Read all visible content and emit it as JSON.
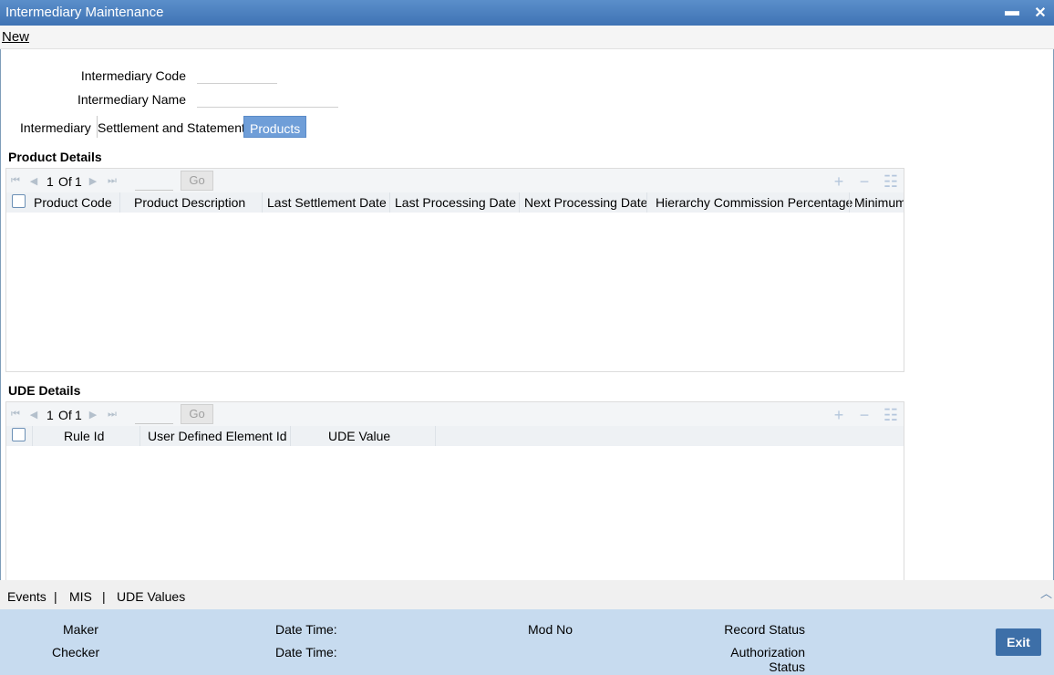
{
  "window": {
    "title": "Intermediary Maintenance",
    "minimize_glyph": "▬",
    "close_glyph": "✕"
  },
  "menu": {
    "new_label": "New"
  },
  "form": {
    "code_label": "Intermediary Code",
    "code_value": "",
    "name_label": "Intermediary Name",
    "name_value": ""
  },
  "tabs": [
    {
      "label": "Intermediary"
    },
    {
      "label": "Settlement and Statement"
    },
    {
      "label": "Products",
      "active": true
    }
  ],
  "product_details": {
    "title": "Product Details",
    "pager": {
      "current": "1",
      "of_label": "Of",
      "total": "1",
      "go_label": "Go"
    },
    "columns": [
      "Product Code",
      "Product Description",
      "Last Settlement Date",
      "Last Processing Date",
      "Next Processing Date",
      "Hierarchy Commission Percentage",
      "Minimum"
    ],
    "rows": []
  },
  "ude_details": {
    "title": "UDE Details",
    "pager": {
      "current": "1",
      "of_label": "Of",
      "total": "1",
      "go_label": "Go"
    },
    "columns": [
      "Rule Id",
      "User Defined Element Id",
      "UDE Value"
    ],
    "rows": []
  },
  "footer_links": {
    "events": "Events",
    "mis": "MIS",
    "ude_values": "UDE Values",
    "separator": "|"
  },
  "status": {
    "maker_label": "Maker",
    "checker_label": "Checker",
    "date_time_label": "Date Time:",
    "mod_no_label": "Mod No",
    "record_status_label": "Record Status",
    "auth_status_label_1": "Authorization",
    "auth_status_label_2": "Status",
    "exit_label": "Exit"
  },
  "icons": {
    "first": "⏮",
    "prev": "◀",
    "next": "▶",
    "last": "⏭",
    "add": "+",
    "remove": "−",
    "list": "☷",
    "collapse": "︿"
  },
  "colors": {
    "title_bar": "#4a7fbf",
    "active_tab": "#6f9ed8",
    "status_bar": "#c7dbef",
    "exit_button": "#3d6fa8"
  }
}
